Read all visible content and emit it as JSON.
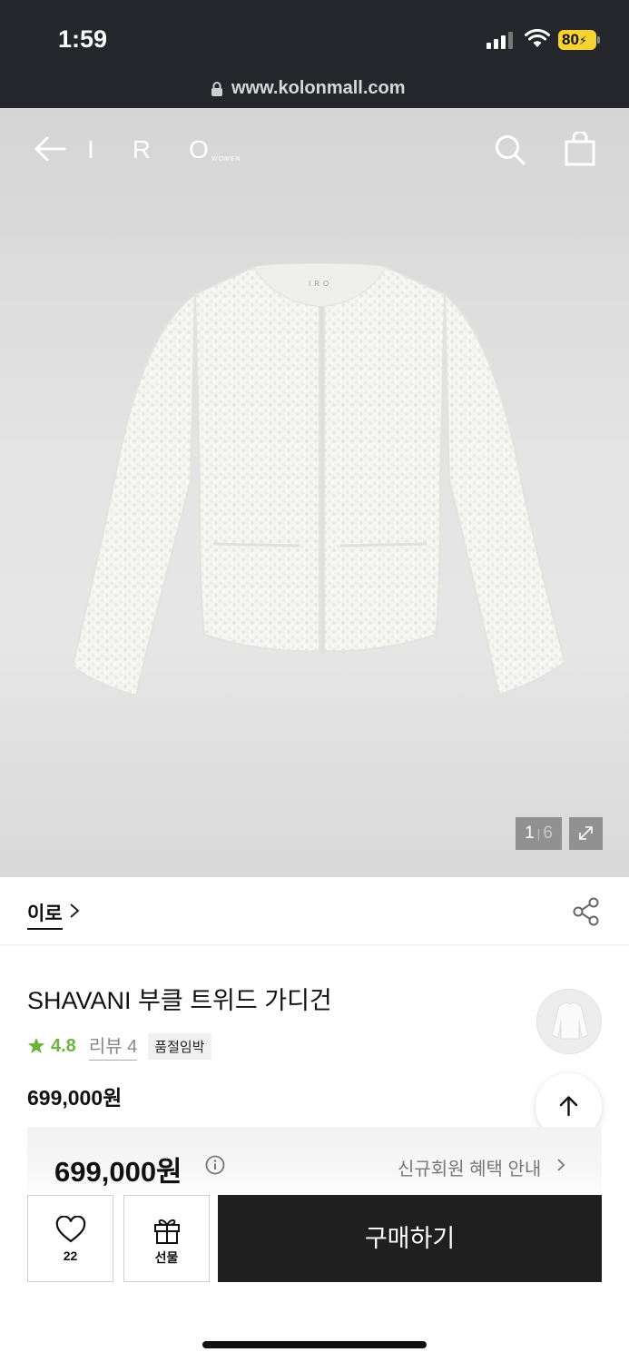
{
  "status_bar": {
    "time": "1:59",
    "battery": "80"
  },
  "url_bar": {
    "url": "www.kolonmall.com"
  },
  "header": {
    "logo": "IRO",
    "logo_sub": "WOMEN"
  },
  "gallery": {
    "current": "1",
    "separator": "|",
    "total": "6"
  },
  "brand": {
    "name": "이로"
  },
  "product": {
    "title": "SHAVANI 부클 트위드 가디건",
    "rating": "4.8",
    "review_label": "리뷰 4",
    "badge": "품절임박",
    "price": "699,000원"
  },
  "benefit": {
    "price": "699,000원",
    "notice": "신규회원 혜택 안내"
  },
  "actions": {
    "wish_count": "22",
    "gift_label": "선물",
    "buy_label": "구매하기"
  },
  "colors": {
    "accent_green": "#6db33f",
    "dark": "#1f1f1f",
    "badge_yellow": "#f6d330"
  }
}
